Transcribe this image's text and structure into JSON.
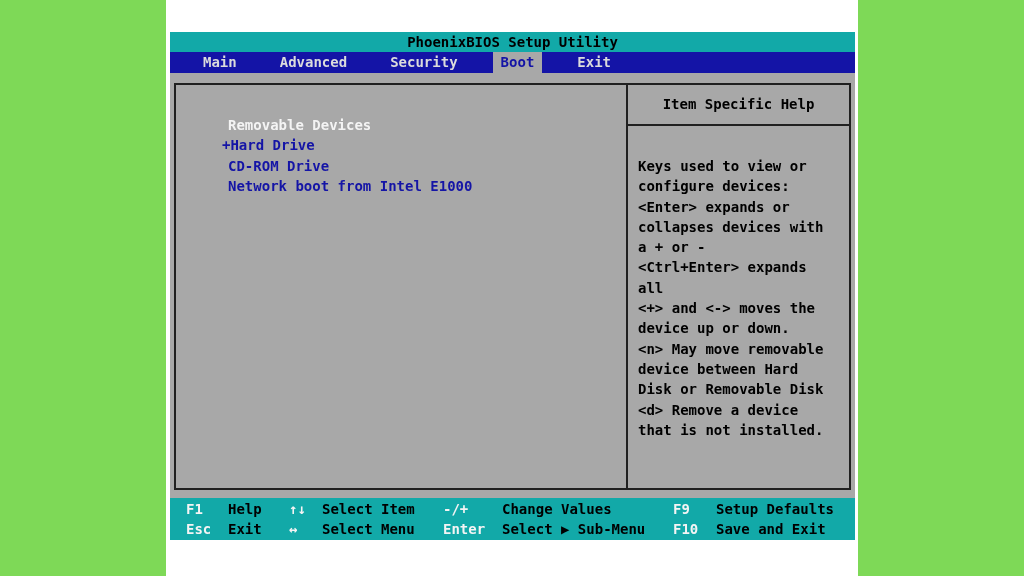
{
  "title": "PhoenixBIOS Setup Utility",
  "tabs": [
    {
      "label": "Main",
      "selected": false
    },
    {
      "label": "Advanced",
      "selected": false
    },
    {
      "label": "Security",
      "selected": false
    },
    {
      "label": "Boot",
      "selected": true
    },
    {
      "label": "Exit",
      "selected": false
    }
  ],
  "boot_list": [
    {
      "kind": "heading",
      "label": "Removable Devices"
    },
    {
      "kind": "group",
      "label": "+Hard Drive"
    },
    {
      "kind": "device",
      "label": "CD-ROM Drive"
    },
    {
      "kind": "device",
      "label": "Network boot from Intel E1000"
    }
  ],
  "help": {
    "title": "Item Specific Help",
    "text": "Keys used to view or\nconfigure devices:\n<Enter> expands or\ncollapses devices with\na + or -\n<Ctrl+Enter> expands\nall\n<+> and <-> moves the\ndevice up or down.\n<n> May move removable\ndevice between Hard\nDisk or Removable Disk\n<d> Remove a device\nthat is not installed."
  },
  "key_legend": [
    [
      {
        "key": "F1",
        "action": "Help"
      },
      {
        "key": "↑↓",
        "action": "Select Item"
      },
      {
        "key": "-/+",
        "action": "Change Values"
      },
      {
        "key": "F9",
        "action": "Setup Defaults"
      }
    ],
    [
      {
        "key": "Esc",
        "action": "Exit"
      },
      {
        "key": "↔",
        "action": "Select Menu"
      },
      {
        "key": "Enter",
        "action": "Select ▶ Sub-Menu"
      },
      {
        "key": "F10",
        "action": "Save and Exit"
      }
    ]
  ]
}
